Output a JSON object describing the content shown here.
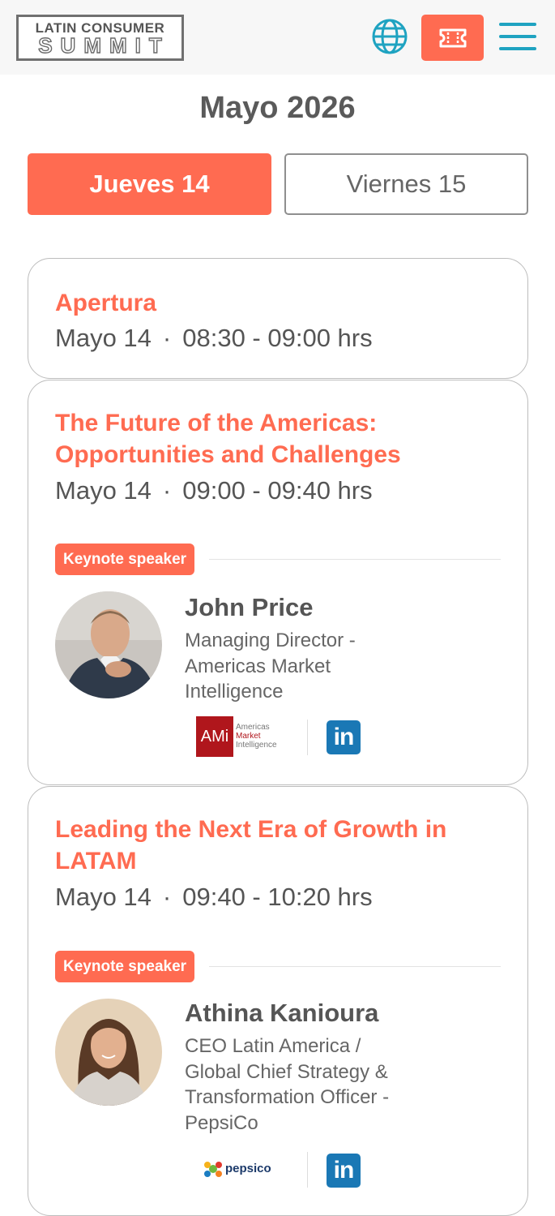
{
  "header": {
    "logo_line1": "LATIN CONSUMER",
    "logo_line2": "SUMMIT",
    "globe_icon": "globe-icon",
    "ticket_icon": "ticket-icon",
    "menu_icon": "hamburger-menu-icon"
  },
  "colors": {
    "accent": "#ff6b51",
    "teal": "#1fa3c1",
    "text": "#555555",
    "linkedin": "#1a78b5"
  },
  "month_title": "Mayo 2026",
  "day_tabs": [
    {
      "label": "Jueves 14",
      "active": true
    },
    {
      "label": "Viernes 15",
      "active": false
    }
  ],
  "sessions": [
    {
      "title": "Apertura",
      "date": "Mayo 14",
      "dot": "·",
      "time": "08:30 - 09:00 hrs"
    },
    {
      "title": "The Future of the Americas: Opportunities and Challenges",
      "date": "Mayo 14",
      "dot": "·",
      "time": "09:00 - 09:40 hrs",
      "badge": "Keynote speaker",
      "speaker": {
        "name": "John Price",
        "role": "Managing Director - Americas Market Intelligence",
        "company_logo_main": "AMi",
        "company_logo_lines": [
          "Americas",
          "Market",
          "Intelligence"
        ],
        "linkedin_label": "in"
      }
    },
    {
      "title": "Leading the Next Era of Growth in LATAM",
      "date": "Mayo 14",
      "dot": "·",
      "time": "09:40 - 10:20 hrs",
      "badge": "Keynote speaker",
      "speaker": {
        "name": "Athina Kanioura",
        "role": "CEO Latin America / Global Chief Strategy & Transformation Officer - PepsiCo",
        "company_logo_text": "pepsico",
        "linkedin_label": "in"
      }
    }
  ]
}
